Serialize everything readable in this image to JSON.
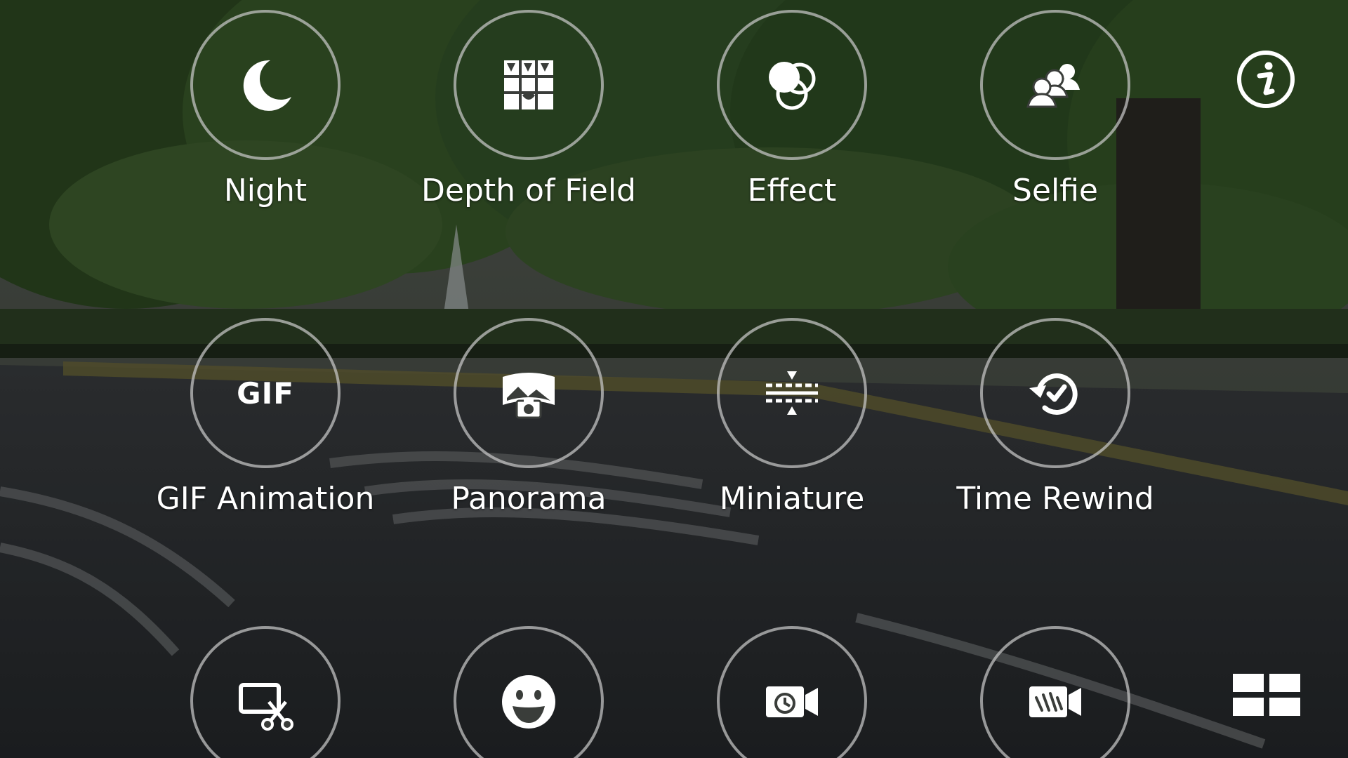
{
  "modes_row1": [
    {
      "id": "night",
      "label": "Night",
      "icon": "moon-icon"
    },
    {
      "id": "dof",
      "label": "Depth of Field",
      "icon": "depth-of-field-icon"
    },
    {
      "id": "effect",
      "label": "Effect",
      "icon": "effect-circles-icon"
    },
    {
      "id": "selfie",
      "label": "Selfie",
      "icon": "group-selfie-icon"
    }
  ],
  "modes_row2": [
    {
      "id": "gif",
      "label": "GIF Animation",
      "icon": "gif-icon",
      "icon_text": "GIF"
    },
    {
      "id": "panorama",
      "label": "Panorama",
      "icon": "panorama-icon"
    },
    {
      "id": "miniature",
      "label": "Miniature",
      "icon": "miniature-icon"
    },
    {
      "id": "time_rewind",
      "label": "Time Rewind",
      "icon": "time-rewind-icon"
    }
  ],
  "modes_row3": [
    {
      "id": "video_trim",
      "icon": "video-trim-icon"
    },
    {
      "id": "sticker",
      "icon": "smiley-icon"
    },
    {
      "id": "timelapse",
      "icon": "timelapse-video-icon"
    },
    {
      "id": "slow_motion",
      "icon": "slow-motion-video-icon"
    }
  ],
  "info_button": {
    "icon": "info-icon"
  },
  "grid_button": {
    "icon": "grid-view-icon"
  },
  "colors": {
    "ring": "#c8c8c8",
    "label": "#ffffff",
    "icon": "#ffffff"
  }
}
